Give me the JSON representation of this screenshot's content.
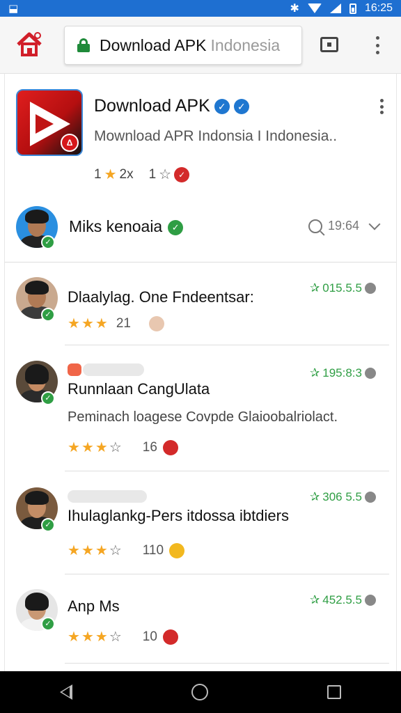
{
  "status_bar": {
    "time": "16:25",
    "left_icon": "notification-icon",
    "bg_color": "#1e6fd1"
  },
  "browser": {
    "url_main": "Download APK",
    "url_dim": "Indonesia",
    "home_icon": "home-icon",
    "lock_icon": "lock-icon",
    "tab_icon": "tab-switcher-icon",
    "menu_icon": "overflow-menu-icon"
  },
  "app": {
    "title": "Download APK",
    "subtitle": "Mownload APR Indonsia I Indonesia..",
    "rating_left": "1",
    "rating_left_suffix": "2x",
    "rating_right": "1",
    "badge_text": "Δ"
  },
  "author": {
    "name": "Miks kenoaia",
    "meta": "19:64"
  },
  "reviews": [
    {
      "name": "Dlaalylag. One Fndeentsar:",
      "score": "015.5.5",
      "count": "21",
      "stars": 3,
      "body": ""
    },
    {
      "name": "Runnlaan CangUlata",
      "body": "Peminach loagese Covpde Glaioobalriolact.",
      "score": "195:8:3",
      "count": "16",
      "stars": 3
    },
    {
      "name": "Ihulaglankg-Pers itdossa ibtdiers",
      "score": "306 5.5",
      "count": "110",
      "stars": 3,
      "body": ""
    },
    {
      "name": "Anp Ms",
      "score": "452.5.5",
      "count": "10",
      "stars": 3,
      "body": ""
    }
  ],
  "colors": {
    "accent_green": "#2f9e44",
    "star": "#f5a623",
    "brand_red": "#d5171a",
    "link_blue": "#1f77d0"
  }
}
